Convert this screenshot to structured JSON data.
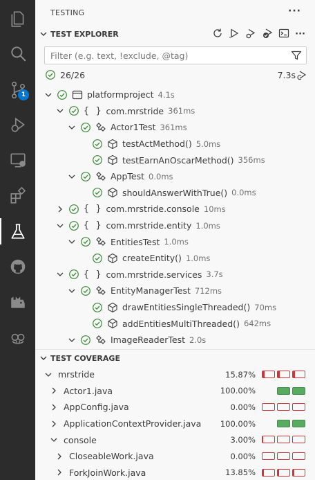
{
  "activity_bar": {
    "items": [
      {
        "name": "explorer-icon"
      },
      {
        "name": "search-icon"
      },
      {
        "name": "source-control-icon",
        "badge": "1"
      },
      {
        "name": "run-debug-icon"
      },
      {
        "name": "remote-explorer-icon"
      },
      {
        "name": "extensions-icon"
      },
      {
        "name": "testing-icon",
        "active": true
      },
      {
        "name": "github-icon"
      },
      {
        "name": "docker-icon"
      },
      {
        "name": "copilot-icon"
      }
    ]
  },
  "sidebar": {
    "title": "TESTING",
    "more_label": "···"
  },
  "explorer": {
    "header": "TEST EXPLORER",
    "filter_placeholder": "Filter (e.g. text, !exclude, @tag)",
    "summary_count": "26/26",
    "summary_duration": "7.3s",
    "tree": [
      {
        "indent": 0,
        "expanded": true,
        "kind": "project",
        "label": "platformproject",
        "desc": "4.1s"
      },
      {
        "indent": 1,
        "expanded": true,
        "kind": "package",
        "label": "com.mrstride",
        "desc": "361ms"
      },
      {
        "indent": 2,
        "expanded": true,
        "kind": "class",
        "label": "Actor1Test",
        "desc": "361ms"
      },
      {
        "indent": 3,
        "kind": "method",
        "label": "testActMethod()",
        "desc": "5.0ms"
      },
      {
        "indent": 3,
        "kind": "method",
        "label": "testEarnAnOscarMethod()",
        "desc": "356ms"
      },
      {
        "indent": 2,
        "expanded": true,
        "kind": "class",
        "label": "AppTest",
        "desc": "0.0ms"
      },
      {
        "indent": 3,
        "kind": "method",
        "label": "shouldAnswerWithTrue()",
        "desc": "0.0ms"
      },
      {
        "indent": 1,
        "expanded": false,
        "kind": "package",
        "label": "com.mrstride.console",
        "desc": "10ms"
      },
      {
        "indent": 1,
        "expanded": true,
        "kind": "package",
        "label": "com.mrstride.entity",
        "desc": "1.0ms"
      },
      {
        "indent": 2,
        "expanded": true,
        "kind": "class",
        "label": "EntitiesTest",
        "desc": "1.0ms"
      },
      {
        "indent": 3,
        "kind": "method",
        "label": "createEntity()",
        "desc": "1.0ms"
      },
      {
        "indent": 1,
        "expanded": true,
        "kind": "package",
        "label": "com.mrstride.services",
        "desc": "3.7s"
      },
      {
        "indent": 2,
        "expanded": true,
        "kind": "class",
        "label": "EntityManagerTest",
        "desc": "712ms"
      },
      {
        "indent": 3,
        "kind": "method",
        "label": "drawEntitiesSingleThreaded()",
        "desc": "70ms"
      },
      {
        "indent": 3,
        "kind": "method",
        "label": "addEntitiesMultiThreaded()",
        "desc": "642ms"
      },
      {
        "indent": 2,
        "expanded": true,
        "kind": "class",
        "label": "ImageReaderTest",
        "desc": "2.0s"
      }
    ]
  },
  "coverage": {
    "header": "TEST COVERAGE",
    "rows": [
      {
        "indent": 0,
        "expanded": true,
        "label": "mrstride",
        "pct": "15.87%",
        "bars": [
          0.16,
          0.16,
          0.16
        ]
      },
      {
        "indent": 1,
        "expanded": false,
        "label": "Actor1.java",
        "pct": "100.00%",
        "bars": [
          1,
          1
        ]
      },
      {
        "indent": 1,
        "expanded": false,
        "label": "AppConfig.java",
        "pct": "0.00%",
        "bars": [
          0,
          0,
          0
        ]
      },
      {
        "indent": 1,
        "expanded": false,
        "label": "ApplicationContextProvider.java",
        "pct": "100.00%",
        "bars": [
          1,
          1
        ]
      },
      {
        "indent": 1,
        "expanded": true,
        "label": "console",
        "pct": "3.00%",
        "bars": [
          0.03,
          0,
          0
        ]
      },
      {
        "indent": 2,
        "expanded": false,
        "label": "CloseableWork.java",
        "pct": "0.00%",
        "bars": [
          0,
          0,
          0
        ]
      },
      {
        "indent": 2,
        "expanded": false,
        "label": "ForkJoinWork.java",
        "pct": "13.85%",
        "bars": [
          0.14,
          0.14,
          0.14
        ]
      }
    ]
  },
  "colors": {
    "pass": "#388a34",
    "accent": "#0078d4",
    "covered": "#5aab62",
    "uncovered": "#d13438"
  }
}
